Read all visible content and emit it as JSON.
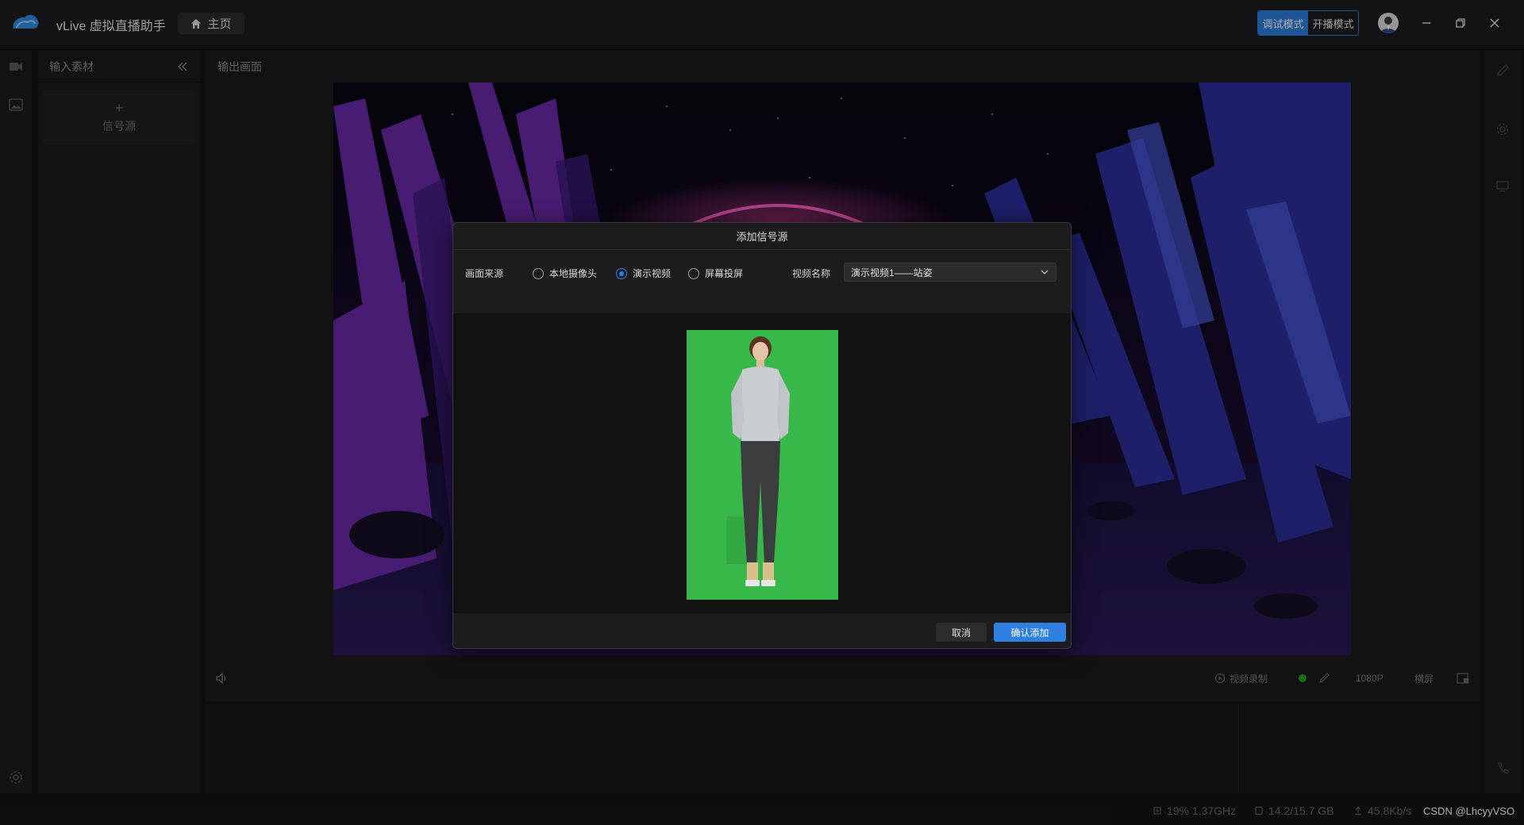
{
  "titlebar": {
    "app_title": "vLive 虚拟直播助手",
    "home_tab": "主页",
    "mode_debug": "调试模式",
    "mode_live": "开播模式"
  },
  "input_panel": {
    "title": "输入素材",
    "add_source_plus": "+",
    "add_source_label": "信号源"
  },
  "output_panel": {
    "title": "输出画面",
    "record_label": "视频录制",
    "resolution": "1080P",
    "orientation": "横屏"
  },
  "statusbar": {
    "cpu": "19% 1.37GHz",
    "memory": "14.2/15.7 GB",
    "upload": "45.8Kb/s",
    "watermark": "CSDN @LhcyyVSO"
  },
  "dialog": {
    "title": "添加信号源",
    "source_label": "画面来源",
    "options": [
      {
        "label": "本地摄像头",
        "checked": false
      },
      {
        "label": "演示视频",
        "checked": true
      },
      {
        "label": "屏幕投屏",
        "checked": false
      }
    ],
    "video_name_label": "视频名称",
    "video_name_value": "演示视频1——站姿",
    "cancel": "取消",
    "confirm": "确认添加"
  },
  "colors": {
    "accent": "#2f7fe0",
    "background": "#141414",
    "panel": "#1b1b1d",
    "green_screen": "#39b84a",
    "live_status": "#1fa61f"
  }
}
